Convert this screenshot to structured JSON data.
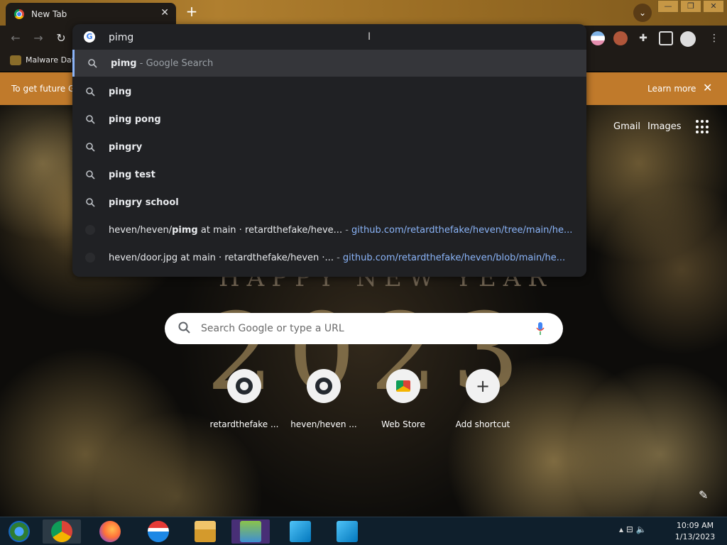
{
  "tab": {
    "title": "New Tab",
    "close": "✕"
  },
  "newtab": "+",
  "window": {
    "min": "—",
    "max": "❐",
    "close": "✕"
  },
  "nav": {
    "back": "←",
    "forward": "→",
    "reload": "↻"
  },
  "bookmark": {
    "label": "Malware Dat"
  },
  "infobar": {
    "text": "To get future G",
    "learn_more": "Learn more",
    "close": "✕"
  },
  "omnibox": {
    "input": "pimg",
    "suggestions": [
      {
        "bold": "pimg",
        "rest": " - Google Search"
      },
      {
        "bold": "ping",
        "rest": ""
      },
      {
        "bold": "ping pong",
        "rest": ""
      },
      {
        "bold": "pingry",
        "rest": ""
      },
      {
        "bold": "ping test",
        "rest": ""
      },
      {
        "bold": "pingry school",
        "rest": ""
      }
    ],
    "history": [
      {
        "pre": "heven/heven/",
        "bold": "pimg",
        "post": " at main · retardthefake/heve...",
        "sep": " - ",
        "url": "github.com/retardthefake/heven/tree/main/he..."
      },
      {
        "pre": "heven/door.jpg at main · retardthefake/heven ·...",
        "bold": "",
        "post": "",
        "sep": " - ",
        "url": "github.com/retardthefake/heven/blob/main/he..."
      }
    ]
  },
  "ntp": {
    "gmail": "Gmail",
    "images": "Images",
    "happy_new_year": "HAPPY NEW YEAR",
    "year": "2023",
    "search_placeholder": "Search Google or type a URL",
    "shortcuts": [
      {
        "label": "retardthefake ..."
      },
      {
        "label": "heven/heven ..."
      },
      {
        "label": "Web Store"
      },
      {
        "label": "Add shortcut"
      }
    ]
  },
  "taskbar": {
    "time": "10:09 AM",
    "date": "1/13/2023"
  }
}
